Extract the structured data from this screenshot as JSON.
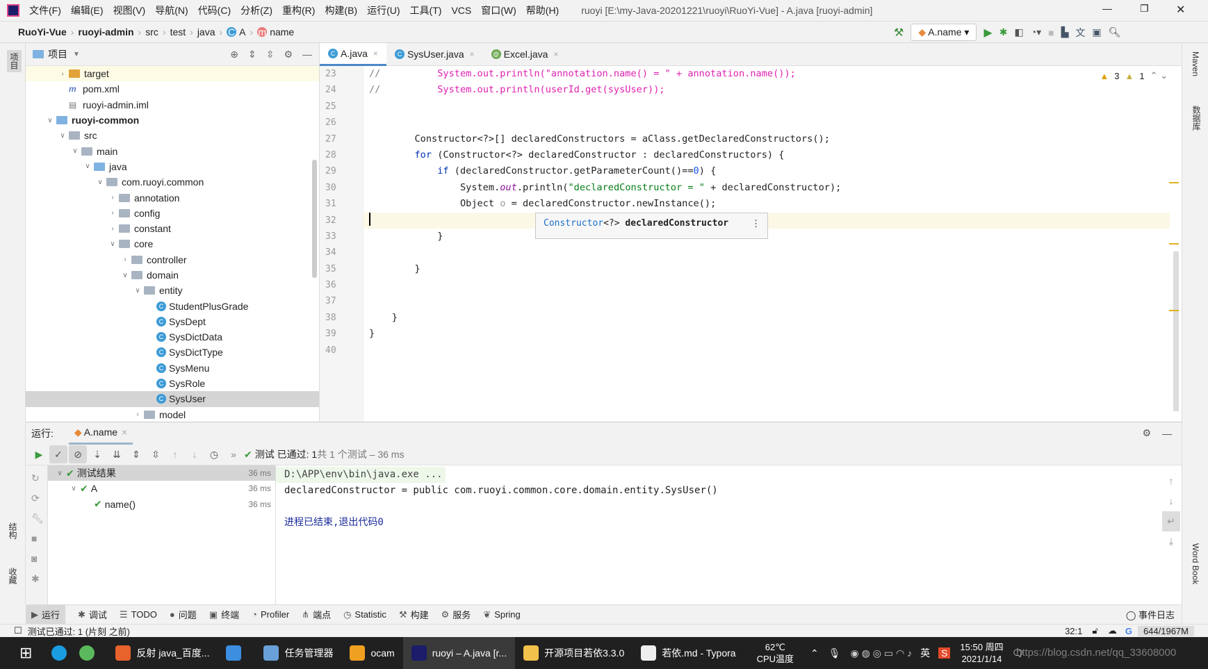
{
  "window": {
    "title": "ruoyi [E:\\my-Java-20201221\\ruoyi\\RuoYi-Vue] - A.java [ruoyi-admin]",
    "menu": [
      "文件(F)",
      "编辑(E)",
      "视图(V)",
      "导航(N)",
      "代码(C)",
      "分析(Z)",
      "重构(R)",
      "构建(B)",
      "运行(U)",
      "工具(T)",
      "VCS",
      "窗口(W)",
      "帮助(H)"
    ]
  },
  "breadcrumb": [
    "RuoYi-Vue",
    "ruoyi-admin",
    "src",
    "test",
    "java",
    "A",
    "name"
  ],
  "toolbar": {
    "run_config": "A.name"
  },
  "left_stripe": {
    "project": "项目",
    "structure": "结构",
    "favorites": "收藏"
  },
  "right_stripe": {
    "maven": "Maven",
    "database": "数据库",
    "wordbook": "Word Book"
  },
  "project": {
    "header": "项目",
    "tree": [
      {
        "label": "target",
        "depth": 2,
        "arrow": "right",
        "icon": "folder-orange",
        "hl": true
      },
      {
        "label": "pom.xml",
        "depth": 2,
        "arrow": "",
        "icon": "maven"
      },
      {
        "label": "ruoyi-admin.iml",
        "depth": 2,
        "arrow": "",
        "icon": "iml"
      },
      {
        "label": "ruoyi-common",
        "depth": 1,
        "arrow": "down",
        "icon": "module",
        "bold": true
      },
      {
        "label": "src",
        "depth": 2,
        "arrow": "down",
        "icon": "folder"
      },
      {
        "label": "main",
        "depth": 3,
        "arrow": "down",
        "icon": "folder"
      },
      {
        "label": "java",
        "depth": 4,
        "arrow": "down",
        "icon": "folder-blue"
      },
      {
        "label": "com.ruoyi.common",
        "depth": 5,
        "arrow": "down",
        "icon": "package"
      },
      {
        "label": "annotation",
        "depth": 6,
        "arrow": "right",
        "icon": "package"
      },
      {
        "label": "config",
        "depth": 6,
        "arrow": "right",
        "icon": "package"
      },
      {
        "label": "constant",
        "depth": 6,
        "arrow": "right",
        "icon": "package"
      },
      {
        "label": "core",
        "depth": 6,
        "arrow": "down",
        "icon": "package"
      },
      {
        "label": "controller",
        "depth": 7,
        "arrow": "right",
        "icon": "package"
      },
      {
        "label": "domain",
        "depth": 7,
        "arrow": "down",
        "icon": "package"
      },
      {
        "label": "entity",
        "depth": 8,
        "arrow": "down",
        "icon": "package"
      },
      {
        "label": "StudentPlusGrade",
        "depth": 9,
        "arrow": "",
        "icon": "class"
      },
      {
        "label": "SysDept",
        "depth": 9,
        "arrow": "",
        "icon": "class"
      },
      {
        "label": "SysDictData",
        "depth": 9,
        "arrow": "",
        "icon": "class"
      },
      {
        "label": "SysDictType",
        "depth": 9,
        "arrow": "",
        "icon": "class"
      },
      {
        "label": "SysMenu",
        "depth": 9,
        "arrow": "",
        "icon": "class"
      },
      {
        "label": "SysRole",
        "depth": 9,
        "arrow": "",
        "icon": "class"
      },
      {
        "label": "SysUser",
        "depth": 9,
        "arrow": "",
        "icon": "class",
        "selected": true
      },
      {
        "label": "model",
        "depth": 8,
        "arrow": "right",
        "icon": "package"
      }
    ]
  },
  "editor": {
    "tabs": [
      {
        "label": "A.java",
        "active": true
      },
      {
        "label": "SysUser.java"
      },
      {
        "label": "Excel.java"
      }
    ],
    "inspections": {
      "warnings": "3",
      "weak_warnings": "1"
    },
    "current_line": 32,
    "lines": [
      {
        "n": "23",
        "t": [
          [
            "cm",
            "//"
          ],
          [
            "mg",
            "          System.out.println(\"annotation.name() = \" + annotation.name());"
          ]
        ]
      },
      {
        "n": "24",
        "t": [
          [
            "cm",
            "//"
          ],
          [
            "mg",
            "          System.out.println(userId.get(sysUser));"
          ]
        ]
      },
      {
        "n": "25",
        "t": []
      },
      {
        "n": "26",
        "t": []
      },
      {
        "n": "27",
        "t": [
          [
            "",
            "        Constructor<?>[] declaredConstructors = aClass.getDeclaredConstructors();"
          ]
        ]
      },
      {
        "n": "28",
        "t": [
          [
            "",
            "        "
          ],
          [
            "kw",
            "for"
          ],
          [
            "",
            " (Constructor<?> declaredConstructor : declaredConstructors) {"
          ]
        ]
      },
      {
        "n": "29",
        "t": [
          [
            "",
            "            "
          ],
          [
            "kw",
            "if"
          ],
          [
            "",
            " (declaredConstructor.getParameterCount()=="
          ],
          [
            "num",
            "0"
          ],
          [
            "",
            ") {"
          ]
        ]
      },
      {
        "n": "30",
        "t": [
          [
            "",
            "                System."
          ],
          [
            "it",
            "out"
          ],
          [
            "",
            ".println("
          ],
          [
            "str",
            "\"declaredConstructor = \""
          ],
          [
            "",
            " + declaredConstructor);"
          ]
        ]
      },
      {
        "n": "31",
        "t": [
          [
            "",
            "                Object "
          ],
          [
            "var",
            "o"
          ],
          [
            "",
            " = declaredConstructor.newInstance();"
          ]
        ]
      },
      {
        "n": "32",
        "t": []
      },
      {
        "n": "33",
        "t": [
          [
            "",
            "            }"
          ]
        ]
      },
      {
        "n": "34",
        "t": []
      },
      {
        "n": "35",
        "t": [
          [
            "",
            "        }"
          ]
        ]
      },
      {
        "n": "36",
        "t": []
      },
      {
        "n": "37",
        "t": []
      },
      {
        "n": "38",
        "t": [
          [
            "",
            "    }"
          ]
        ]
      },
      {
        "n": "39",
        "t": [
          [
            "",
            "}"
          ]
        ]
      },
      {
        "n": "40",
        "t": []
      }
    ],
    "popup": {
      "type": "Constructor",
      "generic": "<?>",
      "name": "declaredConstructor"
    }
  },
  "run": {
    "label": "运行:",
    "tab": "A.name",
    "status_prefix": "测试 已通过: 1",
    "status_suffix": "共 1 个测试 – 36 ms",
    "tests": [
      {
        "label": "测试结果",
        "time": "36 ms",
        "depth": 0,
        "selected": true
      },
      {
        "label": "A",
        "time": "36 ms",
        "depth": 1
      },
      {
        "label": "name()",
        "time": "36 ms",
        "depth": 2
      }
    ],
    "console": [
      "D:\\APP\\env\\bin\\java.exe ...",
      "declaredConstructor = public com.ruoyi.common.core.domain.entity.SysUser()",
      "",
      "进程已结束,退出代码0"
    ]
  },
  "bottom_tools": [
    {
      "icon": "▶",
      "label": "运行",
      "active": true
    },
    {
      "icon": "✱",
      "label": "调试"
    },
    {
      "icon": "☰",
      "label": "TODO"
    },
    {
      "icon": "●",
      "label": "问题"
    },
    {
      "icon": "▣",
      "label": "终端"
    },
    {
      "icon": "◔",
      "label": "Profiler"
    },
    {
      "icon": "⋔",
      "label": "端点"
    },
    {
      "icon": "◷",
      "label": "Statistic"
    },
    {
      "icon": "⚒",
      "label": "构建"
    },
    {
      "icon": "⚙",
      "label": "服务"
    },
    {
      "icon": "❦",
      "label": "Spring"
    }
  ],
  "event_log": "事件日志",
  "status": {
    "message": "测试已通过: 1 (片刻 之前)",
    "position": "32:1",
    "memory": "644/1967M"
  },
  "taskbar": {
    "items": [
      {
        "label": "反射 java_百度...",
        "color": "#e8622c"
      },
      {
        "label": "",
        "color": "#3b8ee0"
      },
      {
        "label": "任务管理器",
        "color": "#6aa0d8"
      },
      {
        "label": "ocam",
        "color": "#f0a020"
      },
      {
        "label": "ruoyi – A.java [r...",
        "color": "#1c1c6a",
        "active": true
      },
      {
        "label": "开源项目若依3.3.0",
        "color": "#f2c14b"
      },
      {
        "label": "若依.md - Typora",
        "color": "#eeeeee"
      }
    ],
    "temp": "62℃",
    "temp_label": "CPU温度",
    "ime": "英",
    "time": "15:50 周四",
    "date": "2021/1/14",
    "watermark": "https://blog.csdn.net/qq_33608000"
  }
}
